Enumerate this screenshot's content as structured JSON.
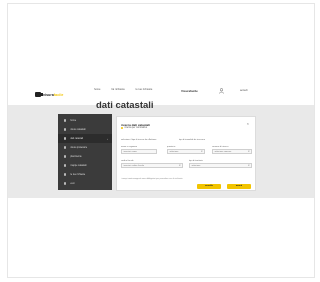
{
  "header": {
    "logo_main": "visura",
    "logo_accent": "facile",
    "nav": [
      "home",
      "fai richiesta",
      "le tue richieste"
    ],
    "brand": "Visurafacile",
    "login": "accedi"
  },
  "page_title": "dati catastali",
  "sidebar": {
    "items": [
      {
        "label": "home",
        "active": false
      },
      {
        "label": "visure catastali",
        "active": false
      },
      {
        "label": "dati catastali",
        "active": true
      },
      {
        "label": "visure ipotecarie",
        "active": false
      },
      {
        "label": "planimetrie",
        "active": false
      },
      {
        "label": "mappe catastali",
        "active": false
      },
      {
        "label": "le tue richieste",
        "active": false
      },
      {
        "label": "esci",
        "active": false
      }
    ]
  },
  "form": {
    "title": "ricerca dati catastali",
    "subtitle": "ricerca per nominativo",
    "label_type": "selezione il tipo di ricerca da effettuare",
    "label_property": "tipo di immobile da ricercare",
    "label_name": "nome e cognome",
    "label_province": "provincia",
    "label_municipality": "comune di ricerca",
    "label_codice": "codice fiscale",
    "label_territory": "tipo di territorio",
    "name_placeholder": "inserisci nome",
    "province_value": "seleziona",
    "municipality_value": "seleziona comune",
    "codice_value": "inserisci codice fiscale",
    "territory_value": "seleziona",
    "note": "i campi contrassegnati sono obbligatori per procedere con la richiesta",
    "cancel_label": "annulla",
    "submit_label": "avanti"
  }
}
